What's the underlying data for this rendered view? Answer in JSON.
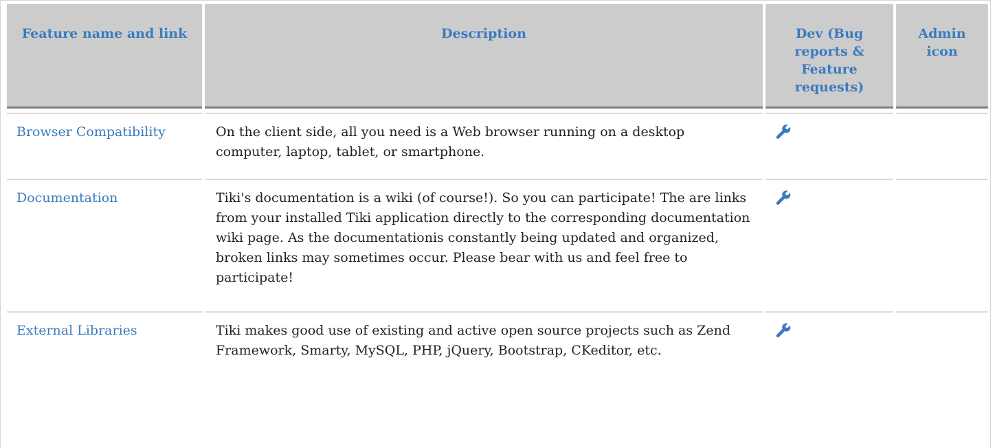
{
  "table": {
    "headers": {
      "feature": "Feature name and link",
      "description": "Description",
      "dev": "Dev (Bug reports & Feature requests)",
      "admin": "Admin icon"
    },
    "rows": [
      {
        "feature": "Browser Compatibility",
        "description": "On the client side, all you need is a Web browser running on a desktop computer, laptop, tablet, or smartphone.",
        "dev_icon": "wrench-icon",
        "admin": ""
      },
      {
        "feature": "Documentation",
        "description": "Tiki's documentation is a wiki (of course!). So you can participate! The are links from your installed Tiki application directly to the corresponding documentation wiki page. As the documentationis constantly being updated and organized, broken links may sometimes occur. Please bear with us and feel free to participate!",
        "dev_icon": "wrench-icon",
        "admin": ""
      },
      {
        "feature": "External Libraries",
        "description": "Tiki makes good use of existing and active open source projects such as Zend Framework, Smarty, MySQL, PHP, jQuery, Bootstrap, CKeditor, etc.",
        "dev_icon": "wrench-icon",
        "admin": ""
      }
    ]
  },
  "colors": {
    "link": "#3a7bbf",
    "header_bg": "#cccccc",
    "header_rule": "#7f7f7f"
  }
}
